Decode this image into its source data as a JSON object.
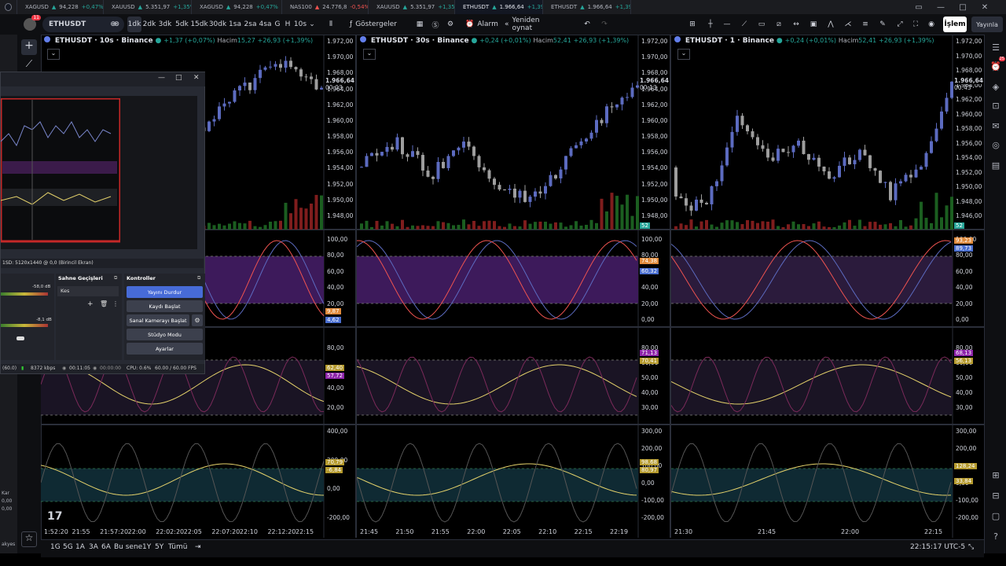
{
  "tabs": [
    {
      "icon_color": "#d4a017",
      "label": "XAGUSD",
      "arrow": "▲",
      "price": "94,228",
      "change": "+0,47%",
      "neg": false
    },
    {
      "icon_color": "#d4a017",
      "label": "XAUUSD",
      "arrow": "▲",
      "price": "5.351,97",
      "change": "+1,35%",
      "neg": false
    },
    {
      "icon_color": "#d4a017",
      "label": "XAGUSD",
      "arrow": "▲",
      "price": "94,228",
      "change": "+0,47%",
      "neg": false
    },
    {
      "icon_color": "#2962ff",
      "label": "NAS100",
      "arrow": "▲",
      "price": "24.776,8",
      "change": "-0,54%",
      "neg": true
    },
    {
      "icon_color": "#d4a017",
      "label": "XAUUSD",
      "arrow": "▲",
      "price": "5.351,97",
      "change": "+1,35%",
      "neg": false
    },
    {
      "icon_color": "#627eea",
      "label": "ETHUSDT",
      "arrow": "▲",
      "price": "1.966,64",
      "change": "+1,39%",
      "neg": false
    },
    {
      "icon_color": "#627eea",
      "label": "ETHUSDT",
      "arrow": "▲",
      "price": "1.966,64",
      "change": "+1,39%",
      "neg": false
    }
  ],
  "toolbar": {
    "symbol": "ETHUSDT",
    "notif_count": "11",
    "intervals": [
      "1dk",
      "2dk",
      "3dk",
      "5dk",
      "15dk",
      "30dk",
      "1sa",
      "2sa",
      "4sa",
      "G",
      "H",
      "10s"
    ],
    "active_interval": "1dk",
    "indicators": "Göstergeler",
    "alarm": "Alarm",
    "replay": "Yeniden oynat",
    "trade": "İşlem",
    "publish": "Yayınla"
  },
  "panes": [
    {
      "title": "ETHUSDT · 10s · Binance",
      "change": "+1,37 (+0,07%)",
      "volume_label": "Hacim",
      "volume": "15,27",
      "volume_change": "+26,93 (+1,39%)",
      "last_price": "1.966,64",
      "countdown": "00:03",
      "price_axis": [
        "1.972,00",
        "1.970,00",
        "1.968,00",
        "1.964,00",
        "1.962,00",
        "1.960,00",
        "1.958,00",
        "1.956,00",
        "1.954,00",
        "1.952,00",
        "1.950,00",
        "1.948,00"
      ],
      "osc1_axis": [
        "100,00",
        "80,00",
        "60,00",
        "40,00",
        "20,00",
        "0,00"
      ],
      "osc1_tags": [
        "9,87",
        "4,62"
      ],
      "osc2_axis": [
        "80,00",
        "60,00",
        "40,00",
        "20,00"
      ],
      "osc2_tags": [
        "62,40",
        "57,72"
      ],
      "osc3_axis": [
        "400,00",
        "200,00",
        "0,00",
        "-200,00"
      ],
      "osc3_tags": [
        "70,79",
        "-6,84"
      ],
      "times": [
        "1:52:20",
        "21:55",
        "21:57:20",
        "22:00",
        "22:02:20",
        "22:05",
        "22:07:20",
        "22:10",
        "22:12:20",
        "22:15"
      ]
    },
    {
      "title": "ETHUSDT · 30s · Binance",
      "change": "+0,24 (+0,01%)",
      "volume_label": "Hacim",
      "volume": "52,41",
      "volume_change": "+26,93 (+1,39%)",
      "last_price": "1.966,64",
      "countdown": "00:13",
      "price_axis": [
        "1.972,00",
        "1.970,00",
        "1.968,00",
        "1.964,00",
        "1.962,00",
        "1.960,00",
        "1.958,00",
        "1.956,00",
        "1.954,00",
        "1.952,00",
        "1.950,00",
        "1.948,00"
      ],
      "vol_tag": "52",
      "osc1_axis": [
        "100,00",
        "80,00",
        "60,00",
        "40,00",
        "20,00",
        "0,00"
      ],
      "osc1_tags": [
        "74,38",
        "60,32"
      ],
      "osc2_axis": [
        "80,00",
        "60,00",
        "50,00",
        "40,00",
        "30,00"
      ],
      "osc2_tags": [
        "71,13",
        "70,41"
      ],
      "osc3_axis": [
        "300,00",
        "200,00",
        "100,00",
        "0,00",
        "-100,00",
        "-200,00"
      ],
      "osc3_tags": [
        "98,68",
        "80,97"
      ],
      "times": [
        "21:45",
        "21:50",
        "21:55",
        "22:00",
        "22:05",
        "22:10",
        "22:15",
        "22:19"
      ]
    },
    {
      "title": "ETHUSDT · 1 · Binance",
      "change": "+0,24 (+0,01%)",
      "volume_label": "Hacim",
      "volume": "52,41",
      "volume_change": "+26,93 (+1,39%)",
      "last_price": "1.966,64",
      "countdown": "00:43",
      "price_axis": [
        "1.972,00",
        "1.970,00",
        "1.968,00",
        "1.964,00",
        "1.962,00",
        "1.960,00",
        "1.958,00",
        "1.956,00",
        "1.954,00",
        "1.952,00",
        "1.950,00",
        "1.948,00",
        "1.946,00"
      ],
      "vol_tag": "52",
      "osc1_axis": [
        "100,00",
        "80,00",
        "60,00",
        "40,00",
        "20,00",
        "0,00"
      ],
      "osc1_tags": [
        "93,23",
        "89,73"
      ],
      "osc2_axis": [
        "80,00",
        "60,00",
        "50,00",
        "40,00",
        "30,00"
      ],
      "osc2_tags": [
        "68,13",
        "56,13"
      ],
      "osc3_axis": [
        "300,00",
        "200,00",
        "100,00",
        "0,00",
        "-100,00",
        "-200,00"
      ],
      "osc3_tags": [
        "128,24",
        "33,84"
      ],
      "times": [
        "21:30",
        "21:45",
        "22:00",
        "22:15"
      ]
    }
  ],
  "bottom": {
    "ranges": [
      "1G",
      "5G",
      "1A",
      "3A",
      "6A",
      "Bu sene",
      "1Y",
      "5Y",
      "Tümü"
    ],
    "clock": "22:15:17 UTC-5"
  },
  "obs": {
    "display_label": "1SD: 5120x1440 @ 0,0 (Birincil Ekran)",
    "mixer_db1": "-58,0 dB",
    "mixer_db2": "-8,1 dB",
    "transitions_header": "Sahne Geçişleri",
    "transition_value": "Kes",
    "controls_header": "Kontroller",
    "controls": [
      "Yayını Durdur",
      "Kaydı Başlat",
      "Sanal Kamerayı Başlat",
      "Stüdyo Modu",
      "Ayarlar"
    ],
    "status_bitrate": "8372 kbps",
    "status_time1": "00:11:05",
    "status_time2": "00:00:00",
    "status_cpu": "CPU: 0.6%",
    "status_fps": "60.00 / 60.00 FPS",
    "status_left": "(60.0)"
  },
  "left_labels": [
    "Kar",
    "0,00",
    "0,00",
    "akyes"
  ]
}
